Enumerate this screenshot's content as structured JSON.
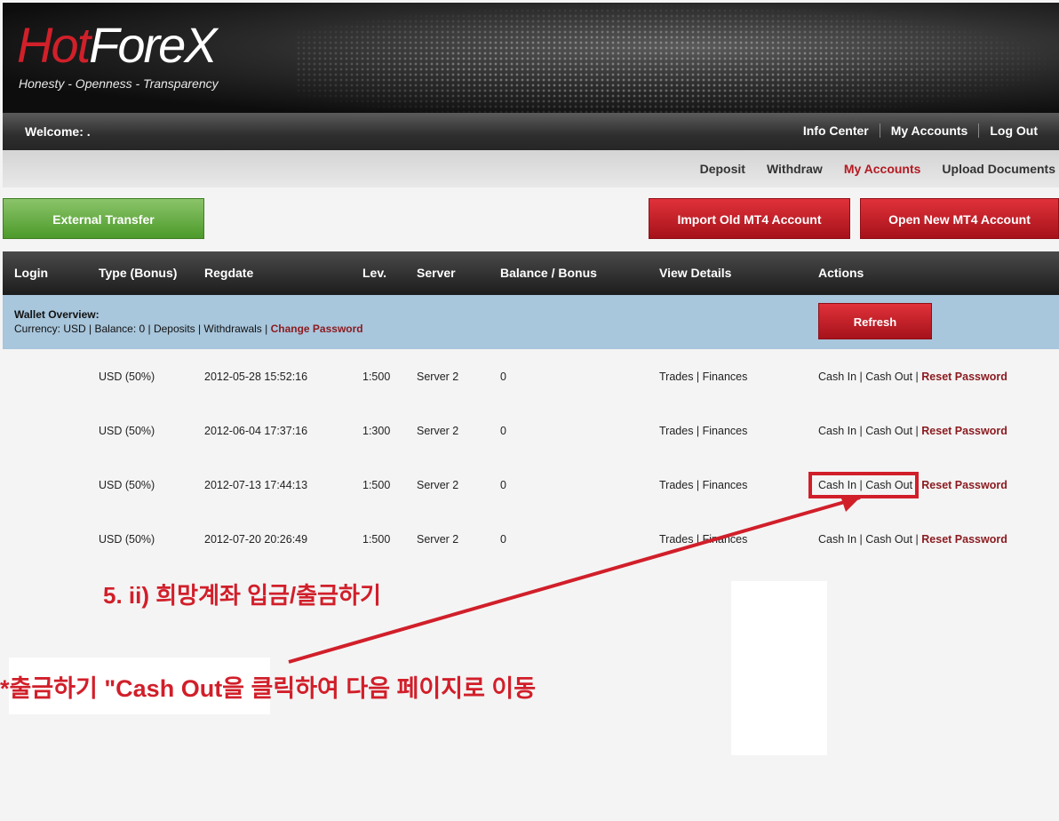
{
  "brand": {
    "logo_hot": "Hot",
    "logo_forex": "ForeX",
    "tagline": "Honesty - Openness - Transparency"
  },
  "topnav": {
    "welcome": "Welcome: .",
    "links": [
      "Info Center",
      "My Accounts",
      "Log Out"
    ]
  },
  "subnav": {
    "links": [
      "Deposit",
      "Withdraw",
      "My Accounts",
      "Upload Documents"
    ],
    "active": "My Accounts"
  },
  "buttons": {
    "external_transfer": "External Transfer",
    "import_old": "Import Old MT4 Account",
    "open_new": "Open New MT4 Account",
    "refresh": "Refresh"
  },
  "table": {
    "headers": [
      "Login",
      "Type (Bonus)",
      "Regdate",
      "Lev.",
      "Server",
      "Balance / Bonus",
      "View Details",
      "Actions"
    ],
    "wallet": {
      "title": "Wallet Overview:",
      "info": "Currency: USD | Balance: 0 | Deposits | Withdrawals | ",
      "change_password": "Change Password"
    },
    "rows": [
      {
        "type": "USD (50%)",
        "regdate": "2012-05-28 15:52:16",
        "lev": "1:500",
        "server": "Server 2",
        "balance": "0",
        "view": "Trades | Finances",
        "actions": "Cash In | Cash Out | ",
        "reset": "Reset Password"
      },
      {
        "type": "USD (50%)",
        "regdate": "2012-06-04 17:37:16",
        "lev": "1:300",
        "server": "Server 2",
        "balance": "0",
        "view": "Trades | Finances",
        "actions": "Cash In | Cash Out | ",
        "reset": "Reset Password"
      },
      {
        "type": "USD (50%)",
        "regdate": "2012-07-13 17:44:13",
        "lev": "1:500",
        "server": "Server 2",
        "balance": "0",
        "view": "Trades | Finances",
        "actions": "Cash In | Cash Out | ",
        "reset": "Reset Password"
      },
      {
        "type": "USD (50%)",
        "regdate": "2012-07-20 20:26:49",
        "lev": "1:500",
        "server": "Server 2",
        "balance": "0",
        "view": "Trades | Finances",
        "actions": "Cash In | Cash Out | ",
        "reset": "Reset Password"
      }
    ]
  },
  "annotations": {
    "step": "5. ii) 희망계좌 입금/출금하기",
    "instruction": "*출금하기  \"Cash Out을 클릭하여 다음 페이지로 이동",
    "color": "#d11f2a"
  }
}
